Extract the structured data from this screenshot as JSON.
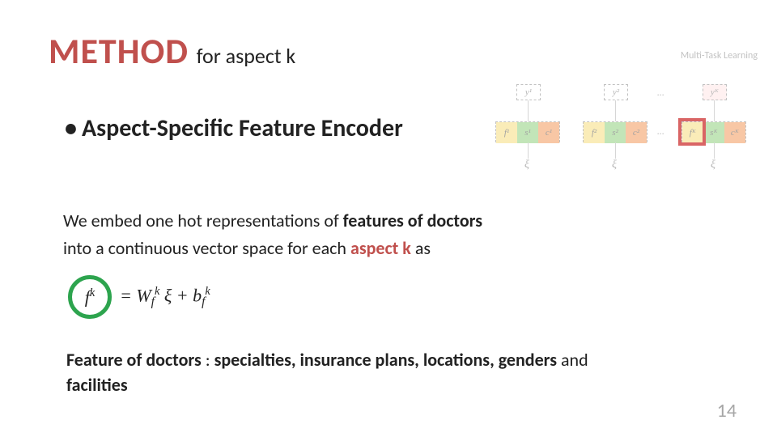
{
  "title": {
    "method": "METHOD",
    "sub": "for aspect k"
  },
  "bullet": {
    "dot": "•",
    "text": "Aspect-Specific Feature Encoder"
  },
  "desc": {
    "l1a": "We embed one hot representations of ",
    "l1b": "features of doctors",
    "l2a": "into a continuous vector space for each ",
    "l2b": "aspect k",
    "l2c": " as"
  },
  "eq": {
    "lhs": "f",
    "lhs_sup": "k",
    "body": "= W",
    "wf_sub": "f",
    "wf_sup": "k",
    "xi": "ξ + b",
    "bf_sub": "f",
    "bf_sup": "k"
  },
  "feat": {
    "lead": "Feature of doctors",
    "colon": " : ",
    "items": "specialties, insurance plans, locations, genders",
    "tail": " and ",
    "last": "facilities"
  },
  "pagenum": "14",
  "diagram": {
    "title": "Multi-Task Learning",
    "y1": "y¹",
    "y2": "y²",
    "yK": "yᴷ",
    "f1": "f¹",
    "s1": "s¹",
    "c1": "c¹",
    "f2": "f²",
    "s2": "s²",
    "c2": "c²",
    "fK": "fᴷ",
    "sK": "sᴷ",
    "cK": "cᴷ",
    "xi": "ξ",
    "dots": "…"
  }
}
